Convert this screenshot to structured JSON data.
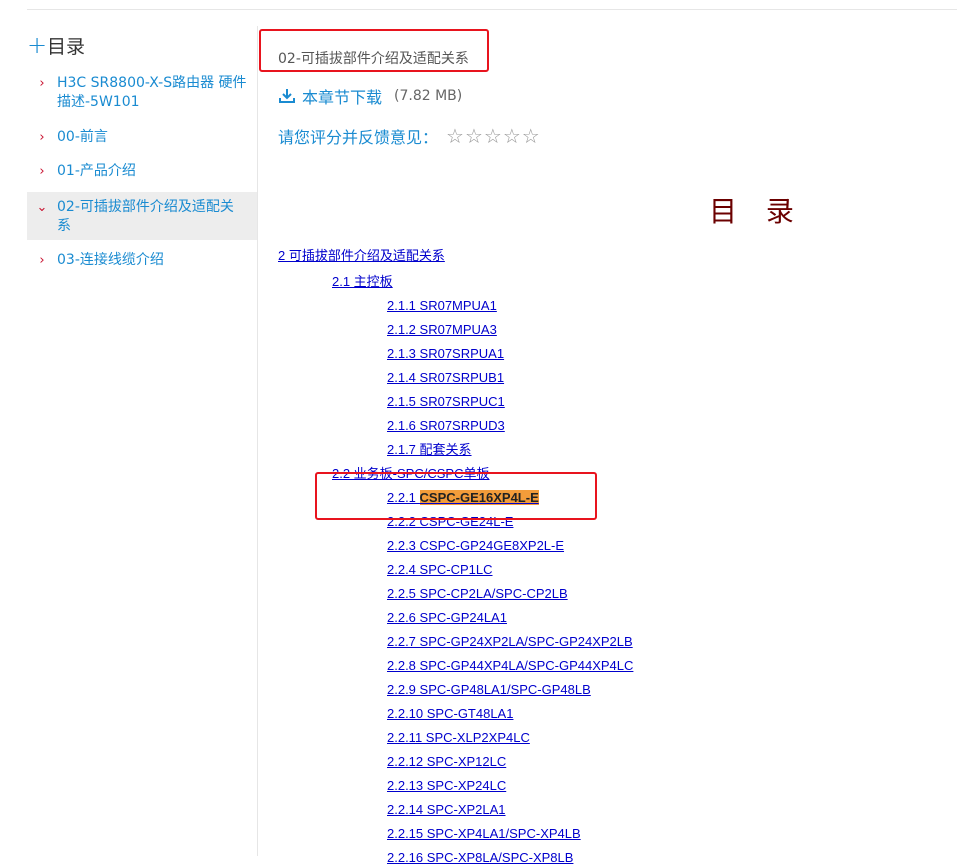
{
  "sidebar": {
    "header": {
      "plus": "+",
      "title": "目录"
    },
    "items": [
      {
        "label": "H3C SR8800-X-S路由器 硬件描述-5W101",
        "chevron": "›"
      },
      {
        "label": "00-前言",
        "chevron": "›"
      },
      {
        "label": "01-产品介绍",
        "chevron": "›"
      },
      {
        "label": "02-可插拔部件介绍及适配关系",
        "chevron": "⌄",
        "active": true
      },
      {
        "label": "03-连接线缆介绍",
        "chevron": "›"
      }
    ]
  },
  "main": {
    "chapter_title": "02-可插拔部件介绍及适配关系",
    "download": {
      "label": "本章节下载",
      "size": "(7.82 MB)"
    },
    "rating": {
      "label": "请您评分并反馈意见：",
      "stars": 5,
      "star_glyph": "☆"
    },
    "doc_title": "目 录",
    "toc": {
      "chapter": "2 可插拔部件介绍及适配关系",
      "section1": "2.1 主控板",
      "section1_items": [
        "2.1.1 SR07MPUA1",
        "2.1.2 SR07MPUA3",
        "2.1.3 SR07SRPUA1",
        "2.1.4 SR07SRPUB1",
        "2.1.5 SR07SRPUC1",
        "2.1.6 SR07SRPUD3",
        "2.1.7 配套关系"
      ],
      "section2": "2.2 业务板-SPC/CSPC单板",
      "section2_first": {
        "num": "2.2.1 ",
        "name": "CSPC-GE16XP4L-E"
      },
      "section2_items": [
        "2.2.2 CSPC-GE24L-E",
        "2.2.3 CSPC-GP24GE8XP2L-E",
        "2.2.4 SPC-CP1LC",
        "2.2.5 SPC-CP2LA/SPC-CP2LB",
        "2.2.6 SPC-GP24LA1",
        "2.2.7 SPC-GP24XP2LA/SPC-GP24XP2LB",
        "2.2.8 SPC-GP44XP4LA/SPC-GP44XP4LC",
        "2.2.9 SPC-GP48LA1/SPC-GP48LB",
        "2.2.10 SPC-GT48LA1",
        "2.2.11 SPC-XLP2XP4LC",
        "2.2.12 SPC-XP12LC",
        "2.2.13 SPC-XP24LC",
        "2.2.14 SPC-XP2LA1",
        "2.2.15 SPC-XP4LA1/SPC-XP4LB",
        "2.2.16 SPC-XP8LA/SPC-XP8LB"
      ]
    }
  },
  "colors": {
    "accent": "#1a8bd1",
    "chevron": "#c8102e",
    "annotation": "#e8141e",
    "highlight": "#f39c3a",
    "link": "#0000cc"
  }
}
